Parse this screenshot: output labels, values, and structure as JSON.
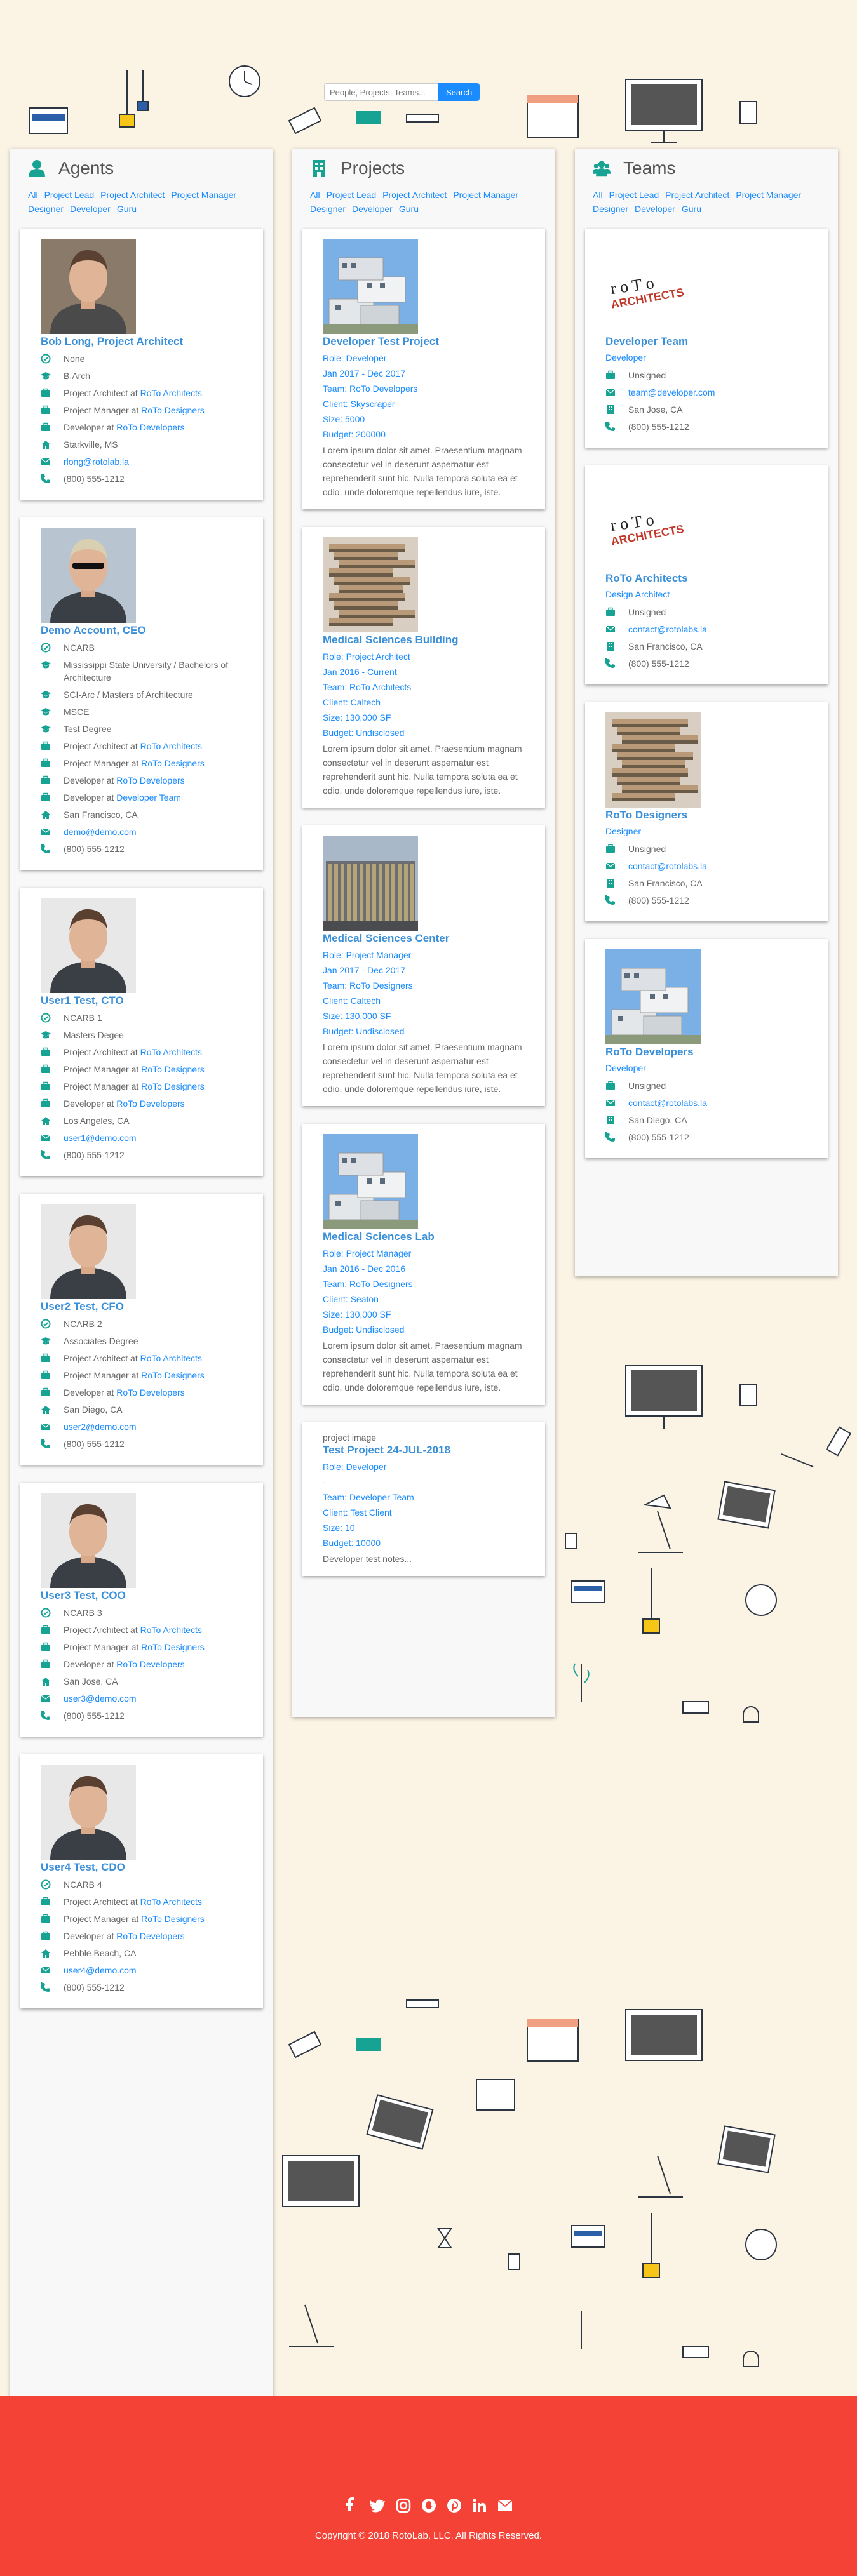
{
  "search": {
    "placeholder": "People, Projects, Teams...",
    "button": "Search"
  },
  "agents": {
    "title": "Agents",
    "filters": [
      "All",
      "Project Lead",
      "Project Architect",
      "Project Manager",
      "Designer",
      "Developer",
      "Guru"
    ],
    "cards": [
      {
        "name": "Bob Long, Project Architect",
        "rows": [
          {
            "icon": "certificate-icon",
            "text": "None"
          },
          {
            "icon": "graduation-cap-icon",
            "text": "B.Arch"
          },
          {
            "icon": "briefcase-icon",
            "text": "Project Architect at ",
            "link": "RoTo Architects"
          },
          {
            "icon": "briefcase-icon",
            "text": "Project Manager at ",
            "link": "RoTo Designers"
          },
          {
            "icon": "briefcase-icon",
            "text": "Developer at ",
            "link": "RoTo Developers"
          },
          {
            "icon": "home-icon",
            "text": "Starkville, MS"
          },
          {
            "icon": "envelope-icon",
            "link": "rlong@rotolab.la"
          },
          {
            "icon": "phone-icon",
            "text": "(800) 555-1212"
          }
        ]
      },
      {
        "name": "Demo Account, CEO",
        "rows": [
          {
            "icon": "certificate-icon",
            "text": "NCARB"
          },
          {
            "icon": "graduation-cap-icon",
            "text": "Mississippi State University / Bachelors of Architecture"
          },
          {
            "icon": "graduation-cap-icon",
            "text": "SCI-Arc / Masters of Architecture"
          },
          {
            "icon": "graduation-cap-icon",
            "text": "MSCE"
          },
          {
            "icon": "graduation-cap-icon",
            "text": "Test Degree"
          },
          {
            "icon": "briefcase-icon",
            "text": "Project Architect at ",
            "link": "RoTo Architects"
          },
          {
            "icon": "briefcase-icon",
            "text": "Project Manager at ",
            "link": "RoTo Designers"
          },
          {
            "icon": "briefcase-icon",
            "text": "Developer at ",
            "link": "RoTo Developers"
          },
          {
            "icon": "briefcase-icon",
            "text": "Developer at ",
            "link": "Developer Team"
          },
          {
            "icon": "home-icon",
            "text": "San Francisco, CA"
          },
          {
            "icon": "envelope-icon",
            "link": "demo@demo.com"
          },
          {
            "icon": "phone-icon",
            "text": "(800) 555-1212"
          }
        ]
      },
      {
        "name": "User1 Test, CTO",
        "rows": [
          {
            "icon": "certificate-icon",
            "text": "NCARB 1"
          },
          {
            "icon": "graduation-cap-icon",
            "text": "Masters Degee"
          },
          {
            "icon": "briefcase-icon",
            "text": "Project Architect at ",
            "link": "RoTo Architects"
          },
          {
            "icon": "briefcase-icon",
            "text": "Project Manager at ",
            "link": "RoTo Designers"
          },
          {
            "icon": "briefcase-icon",
            "text": "Project Manager at ",
            "link": "RoTo Designers"
          },
          {
            "icon": "briefcase-icon",
            "text": "Developer at ",
            "link": "RoTo Developers"
          },
          {
            "icon": "home-icon",
            "text": "Los Angeles, CA"
          },
          {
            "icon": "envelope-icon",
            "link": "user1@demo.com"
          },
          {
            "icon": "phone-icon",
            "text": "(800) 555-1212"
          }
        ]
      },
      {
        "name": "User2 Test, CFO",
        "rows": [
          {
            "icon": "certificate-icon",
            "text": "NCARB 2"
          },
          {
            "icon": "graduation-cap-icon",
            "text": "Associates Degree"
          },
          {
            "icon": "briefcase-icon",
            "text": "Project Architect at ",
            "link": "RoTo Architects"
          },
          {
            "icon": "briefcase-icon",
            "text": "Project Manager at ",
            "link": "RoTo Designers"
          },
          {
            "icon": "briefcase-icon",
            "text": "Developer at ",
            "link": "RoTo Developers"
          },
          {
            "icon": "home-icon",
            "text": "San Diego, CA"
          },
          {
            "icon": "envelope-icon",
            "link": "user2@demo.com"
          },
          {
            "icon": "phone-icon",
            "text": "(800) 555-1212"
          }
        ]
      },
      {
        "name": "User3 Test, COO",
        "rows": [
          {
            "icon": "certificate-icon",
            "text": "NCARB 3"
          },
          {
            "icon": "briefcase-icon",
            "text": "Project Architect at ",
            "link": "RoTo Architects"
          },
          {
            "icon": "briefcase-icon",
            "text": "Project Manager at ",
            "link": "RoTo Designers"
          },
          {
            "icon": "briefcase-icon",
            "text": "Developer at ",
            "link": "RoTo Developers"
          },
          {
            "icon": "home-icon",
            "text": "San Jose, CA"
          },
          {
            "icon": "envelope-icon",
            "link": "user3@demo.com"
          },
          {
            "icon": "phone-icon",
            "text": "(800) 555-1212"
          }
        ]
      },
      {
        "name": "User4 Test, CDO",
        "rows": [
          {
            "icon": "certificate-icon",
            "text": "NCARB 4"
          },
          {
            "icon": "briefcase-icon",
            "text": "Project Architect at ",
            "link": "RoTo Architects"
          },
          {
            "icon": "briefcase-icon",
            "text": "Project Manager at ",
            "link": "RoTo Designers"
          },
          {
            "icon": "briefcase-icon",
            "text": "Developer at ",
            "link": "RoTo Developers"
          },
          {
            "icon": "home-icon",
            "text": "Pebble Beach, CA"
          },
          {
            "icon": "envelope-icon",
            "link": "user4@demo.com"
          },
          {
            "icon": "phone-icon",
            "text": "(800) 555-1212"
          }
        ]
      }
    ]
  },
  "projects": {
    "title": "Projects",
    "filters": [
      "All",
      "Project Lead",
      "Project Architect",
      "Project Manager",
      "Designer",
      "Developer",
      "Guru"
    ],
    "cards": [
      {
        "name": "Developer Test Project",
        "image": "stacked-boxes",
        "lines": [
          "Role: Developer",
          "Jan 2017 - Dec 2017",
          "Team: RoTo Developers",
          "Client: Skyscraper",
          "Size: 5000",
          "Budget: 200000"
        ],
        "desc": "Lorem ipsum dolor sit amet. Praesentium magnam consectetur vel in deserunt aspernatur est reprehenderit sunt hic. Nulla tempora soluta ea et odio, unde doloremque repellendus iure, iste."
      },
      {
        "name": "Medical Sciences Building",
        "image": "layered-slabs",
        "lines": [
          "Role: Project Architect",
          "Jan 2016 - Current",
          "Team: RoTo Architects",
          "Client: Caltech",
          "Size: 130,000 SF",
          "Budget: Undisclosed"
        ],
        "desc": "Lorem ipsum dolor sit amet. Praesentium magnam consectetur vel in deserunt aspernatur est reprehenderit sunt hic. Nulla tempora soluta ea et odio, unde doloremque repellendus iure, iste."
      },
      {
        "name": "Medical Sciences Center",
        "image": "glass-facade",
        "lines": [
          "Role: Project Manager",
          "Jan 2017 - Dec 2017",
          "Team: RoTo Designers",
          "Client: Caltech",
          "Size: 130,000 SF",
          "Budget: Undisclosed"
        ],
        "desc": "Lorem ipsum dolor sit amet. Praesentium magnam consectetur vel in deserunt aspernatur est reprehenderit sunt hic. Nulla tempora soluta ea et odio, unde doloremque repellendus iure, iste."
      },
      {
        "name": "Medical Sciences Lab",
        "image": "stacked-boxes",
        "lines": [
          "Role: Project Manager",
          "Jan 2016 - Dec 2016",
          "Team: RoTo Designers",
          "Client: Seaton",
          "Size: 130,000 SF",
          "Budget: Undisclosed"
        ],
        "desc": "Lorem ipsum dolor sit amet. Praesentium magnam consectetur vel in deserunt aspernatur est reprehenderit sunt hic. Nulla tempora soluta ea et odio, unde doloremque repellendus iure, iste."
      },
      {
        "name": "Test Project 24-JUL-2018",
        "image": "none",
        "image_alt": "project image",
        "lines": [
          "Role: Developer",
          "-",
          "Team: Developer Team",
          "Client: Test Client",
          "Size: 10",
          "Budget: 10000"
        ],
        "desc": "Developer test notes..."
      }
    ]
  },
  "teams": {
    "title": "Teams",
    "filters": [
      "All",
      "Project Lead",
      "Project Architect",
      "Project Manager",
      "Designer",
      "Developer",
      "Guru"
    ],
    "cards": [
      {
        "name": "Developer Team",
        "subtitle": "Developer",
        "image": "roto-logo",
        "logo_text": "RoTo ARCHITECTS",
        "rows": [
          {
            "icon": "briefcase-icon",
            "text": "Unsigned"
          },
          {
            "icon": "envelope-icon",
            "link": "team@developer.com"
          },
          {
            "icon": "building-icon",
            "text": "San Jose, CA"
          },
          {
            "icon": "phone-icon",
            "text": "(800) 555-1212"
          }
        ]
      },
      {
        "name": "RoTo Architects",
        "subtitle": "Design Architect",
        "image": "roto-logo",
        "logo_text": "RoTo ARCHITECTS",
        "rows": [
          {
            "icon": "briefcase-icon",
            "text": "Unsigned"
          },
          {
            "icon": "envelope-icon",
            "link": "contact@rotolabs.la"
          },
          {
            "icon": "building-icon",
            "text": "San Francisco, CA"
          },
          {
            "icon": "phone-icon",
            "text": "(800) 555-1212"
          }
        ]
      },
      {
        "name": "RoTo Designers",
        "subtitle": "Designer",
        "image": "layered-slabs",
        "rows": [
          {
            "icon": "briefcase-icon",
            "text": "Unsigned"
          },
          {
            "icon": "envelope-icon",
            "link": "contact@rotolabs.la"
          },
          {
            "icon": "building-icon",
            "text": "San Francisco, CA"
          },
          {
            "icon": "phone-icon",
            "text": "(800) 555-1212"
          }
        ]
      },
      {
        "name": "RoTo Developers",
        "subtitle": "Developer",
        "image": "stacked-boxes",
        "rows": [
          {
            "icon": "briefcase-icon",
            "text": "Unsigned"
          },
          {
            "icon": "envelope-icon",
            "link": "contact@rotolabs.la"
          },
          {
            "icon": "building-icon",
            "text": "San Diego, CA"
          },
          {
            "icon": "phone-icon",
            "text": "(800) 555-1212"
          }
        ]
      }
    ]
  },
  "footer": {
    "social_icons": [
      "facebook-icon",
      "twitter-icon",
      "instagram-icon",
      "snapchat-icon",
      "pinterest-icon",
      "linkedin-icon",
      "email-icon"
    ],
    "copyright": "Copyright © 2018 RotoLab, LLC. All Rights Reserved."
  },
  "colors": {
    "background": "#fbf3e4",
    "link": "#1a8cff",
    "title": "#3a8fd9",
    "accent": "#16a394",
    "footer": "#f44336"
  }
}
